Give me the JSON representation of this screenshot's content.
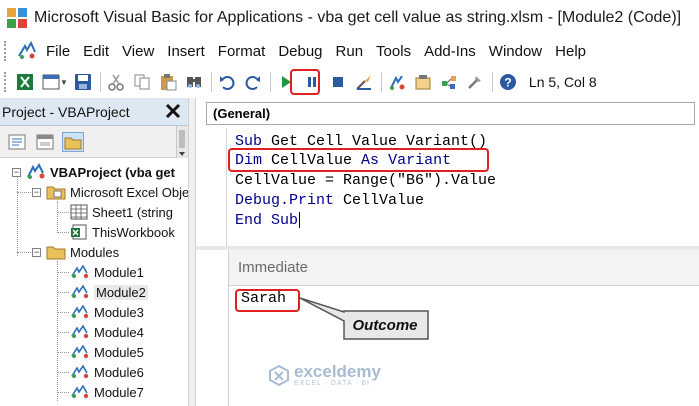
{
  "window": {
    "title": "Microsoft Visual Basic for Applications - vba get cell value as string.xlsm - [Module2 (Code)]"
  },
  "menu": {
    "items": [
      "File",
      "Edit",
      "View",
      "Insert",
      "Format",
      "Debug",
      "Run",
      "Tools",
      "Add-Ins",
      "Window",
      "Help"
    ]
  },
  "toolbar": {
    "status": "Ln 5, Col 8",
    "icons": [
      "excel-icon",
      "insert-userform-icon",
      "save-icon",
      "cut-icon",
      "copy-icon",
      "paste-icon",
      "find-icon",
      "undo-icon",
      "redo-icon",
      "run-icon",
      "break-icon",
      "reset-icon",
      "design-mode-icon",
      "project-explorer-icon",
      "properties-icon",
      "object-browser-icon",
      "toolbox-icon",
      "help-icon"
    ]
  },
  "project": {
    "title": "Project - VBAProject",
    "tree": {
      "root": "VBAProject (vba get",
      "excel_objects": "Microsoft Excel Obje",
      "sheet1": "Sheet1 (string",
      "thisworkbook": "ThisWorkbook",
      "modules_folder": "Modules",
      "modules": [
        "Module1",
        "Module2",
        "Module3",
        "Module4",
        "Module5",
        "Module6",
        "Module7"
      ],
      "selected_module": "Module2"
    }
  },
  "code": {
    "object_dropdown": "(General)",
    "lines": [
      [
        {
          "t": "Sub",
          "k": true
        },
        {
          "t": " Get Cell Value Variant()",
          "k": false
        }
      ],
      [
        {
          "t": "Dim",
          "k": true
        },
        {
          "t": " CellValue ",
          "k": false
        },
        {
          "t": "As",
          "k": true
        },
        {
          "t": " Variant",
          "k": true
        }
      ],
      [
        {
          "t": "CellValue = Range(\"B6\").Value",
          "k": false
        }
      ],
      [
        {
          "t": "Debug.Print",
          "k": true
        },
        {
          "t": " CellValue",
          "k": false
        }
      ],
      [
        {
          "t": "End Sub",
          "k": true
        }
      ]
    ]
  },
  "immediate": {
    "title": "Immediate",
    "output": "Sarah"
  },
  "annotation": {
    "callout": "Outcome",
    "highlight_color": "#e02020"
  },
  "watermark": {
    "name": "exceldemy",
    "tagline": "EXCEL · DATA · BI"
  },
  "colors": {
    "keyword": "#00008b",
    "panel_header": "#dde8f3"
  }
}
